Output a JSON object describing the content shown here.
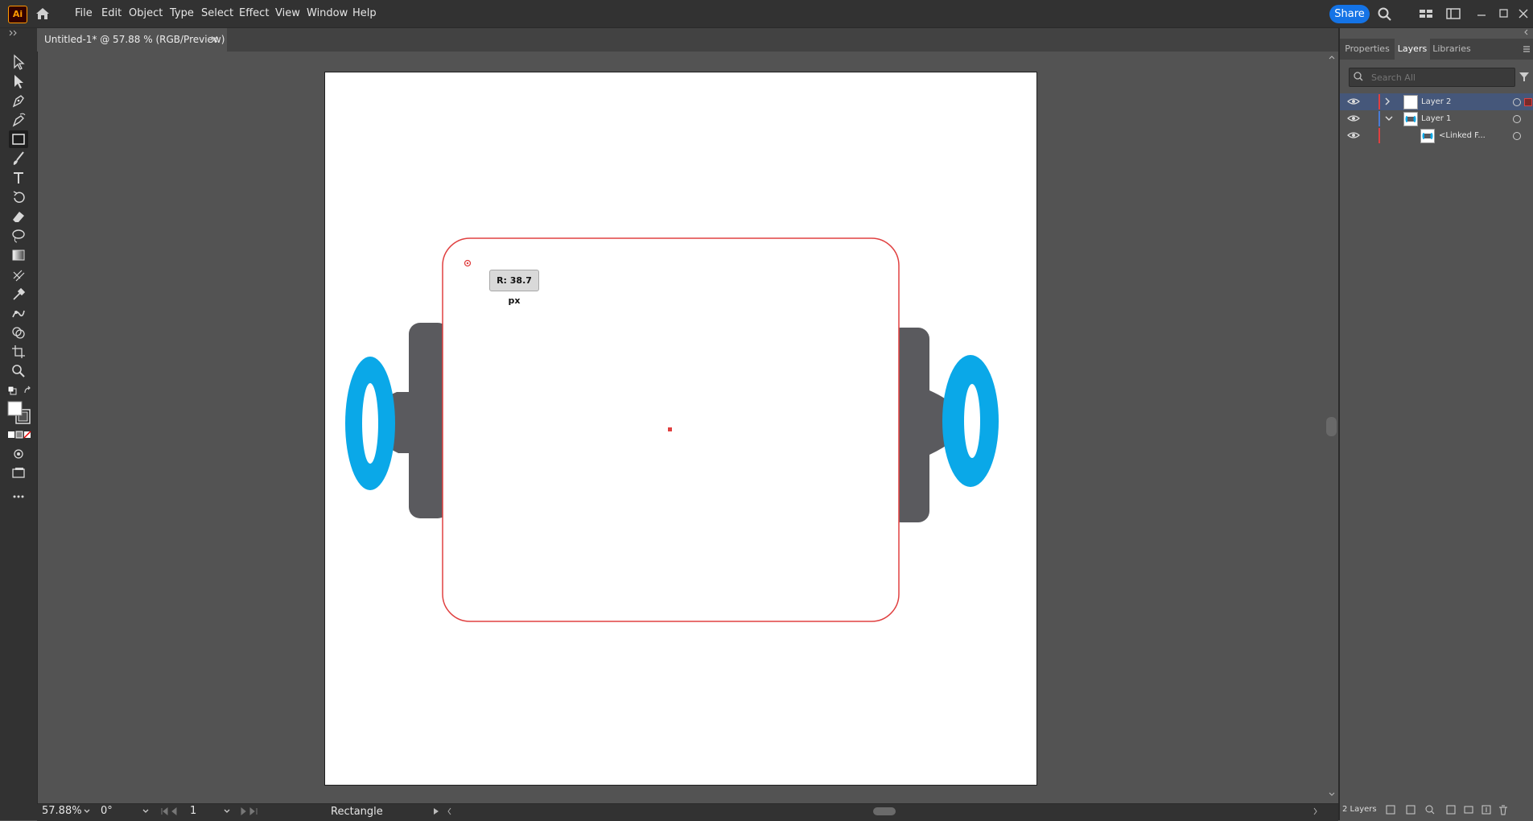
{
  "app": {
    "logo_text": "Ai"
  },
  "menu": [
    {
      "label": "File"
    },
    {
      "label": "Edit"
    },
    {
      "label": "Object"
    },
    {
      "label": "Type"
    },
    {
      "label": "Select"
    },
    {
      "label": "Effect"
    },
    {
      "label": "View"
    },
    {
      "label": "Window"
    },
    {
      "label": "Help"
    }
  ],
  "header": {
    "share_label": "Share"
  },
  "document": {
    "tab_title": "Untitled-1* @ 57.88 % (RGB/Preview)",
    "close_glyph": "×"
  },
  "canvas": {
    "radius_tooltip": "R: 38.7 px",
    "accent_stroke": "#e04040",
    "wheel_color": "#0aa8e8",
    "body_color": "#5a5a5e"
  },
  "status": {
    "zoom": "57.88%",
    "rotation": "0°",
    "artboard_number": "1",
    "current_tool": "Rectangle"
  },
  "panel": {
    "tabs": [
      {
        "label": "Properties"
      },
      {
        "label": "Layers"
      },
      {
        "label": "Libraries"
      }
    ],
    "search_placeholder": "Search All",
    "layers": [
      {
        "name": "Layer 2",
        "color": "#e04040",
        "expanded": false,
        "selected": true
      },
      {
        "name": "Layer 1",
        "color": "#4a7cd6",
        "expanded": true,
        "selected": false
      },
      {
        "name": "<Linked F...",
        "color": "#e04040",
        "child": true
      }
    ],
    "footer_count": "2 Layers"
  }
}
